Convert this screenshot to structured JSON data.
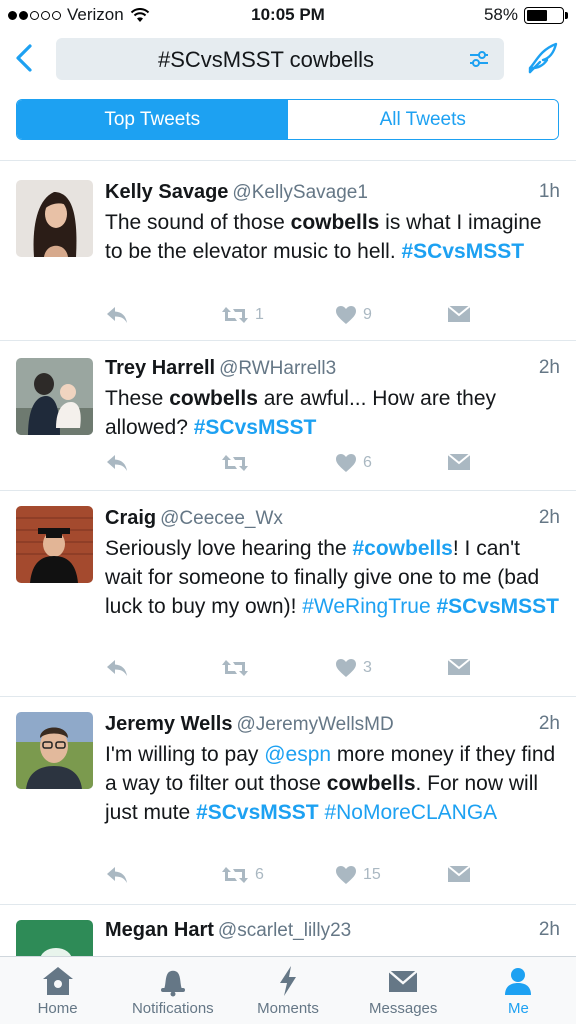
{
  "status": {
    "carrier": "Verizon",
    "time": "10:05 PM",
    "battery": "58%",
    "battery_level": 0.58,
    "signal_bars_filled": 2,
    "signal_bars_total": 5
  },
  "nav": {
    "query": "#SCvsMSST cowbells"
  },
  "tabs": {
    "top": "Top Tweets",
    "all": "All Tweets",
    "selected": "Top Tweets"
  },
  "colors": {
    "accent": "#1da1f2",
    "muted": "#aab8c2"
  },
  "tweets": [
    {
      "name": "Kelly Savage",
      "handle": "@KellySavage1",
      "time": "1h",
      "text": [
        {
          "t": "The sound of those "
        },
        {
          "t": "cowbells",
          "s": "b"
        },
        {
          "t": " is what I imagine to be the elevator music to hell. "
        },
        {
          "t": "#SCvsMSST",
          "s": "tagb"
        }
      ],
      "retweets": "1",
      "likes": "9"
    },
    {
      "name": "Trey Harrell",
      "handle": "@RWHarrell3",
      "time": "2h",
      "text": [
        {
          "t": "These "
        },
        {
          "t": "cowbells",
          "s": "b"
        },
        {
          "t": " are awful... How are they allowed? "
        },
        {
          "t": "#SCvsMSST",
          "s": "tagb"
        }
      ],
      "retweets": "",
      "likes": "6"
    },
    {
      "name": "Craig",
      "handle": "@Ceecee_Wx",
      "time": "2h",
      "text": [
        {
          "t": "Seriously love hearing the "
        },
        {
          "t": "#cowbells",
          "s": "tagb"
        },
        {
          "t": "! I can't wait for someone to finally give one to me (bad luck to buy my own)! "
        },
        {
          "t": "#WeRingTrue",
          "s": "tag"
        },
        {
          "t": " "
        },
        {
          "t": "#SCvsMSST",
          "s": "tagb"
        }
      ],
      "retweets": "",
      "likes": "3"
    },
    {
      "name": "Jeremy Wells",
      "handle": "@JeremyWellsMD",
      "time": "2h",
      "text": [
        {
          "t": "I'm willing to pay "
        },
        {
          "t": "@espn",
          "s": "tag"
        },
        {
          "t": " more money if they find a way to filter out those "
        },
        {
          "t": "cowbells",
          "s": "b"
        },
        {
          "t": ". For now will just mute "
        },
        {
          "t": "#SCvsMSST",
          "s": "tagb"
        },
        {
          "t": " "
        },
        {
          "t": "#NoMoreCLANGA",
          "s": "tag"
        }
      ],
      "retweets": "6",
      "likes": "15"
    },
    {
      "name": "Megan Hart",
      "handle": "@scarlet_lilly23",
      "time": "2h"
    }
  ],
  "tabbar": [
    {
      "label": "Home",
      "icon": "home-icon"
    },
    {
      "label": "Notifications",
      "icon": "bell-icon"
    },
    {
      "label": "Moments",
      "icon": "lightning-icon"
    },
    {
      "label": "Messages",
      "icon": "envelope-icon"
    },
    {
      "label": "Me",
      "icon": "person-icon",
      "active": true
    }
  ]
}
